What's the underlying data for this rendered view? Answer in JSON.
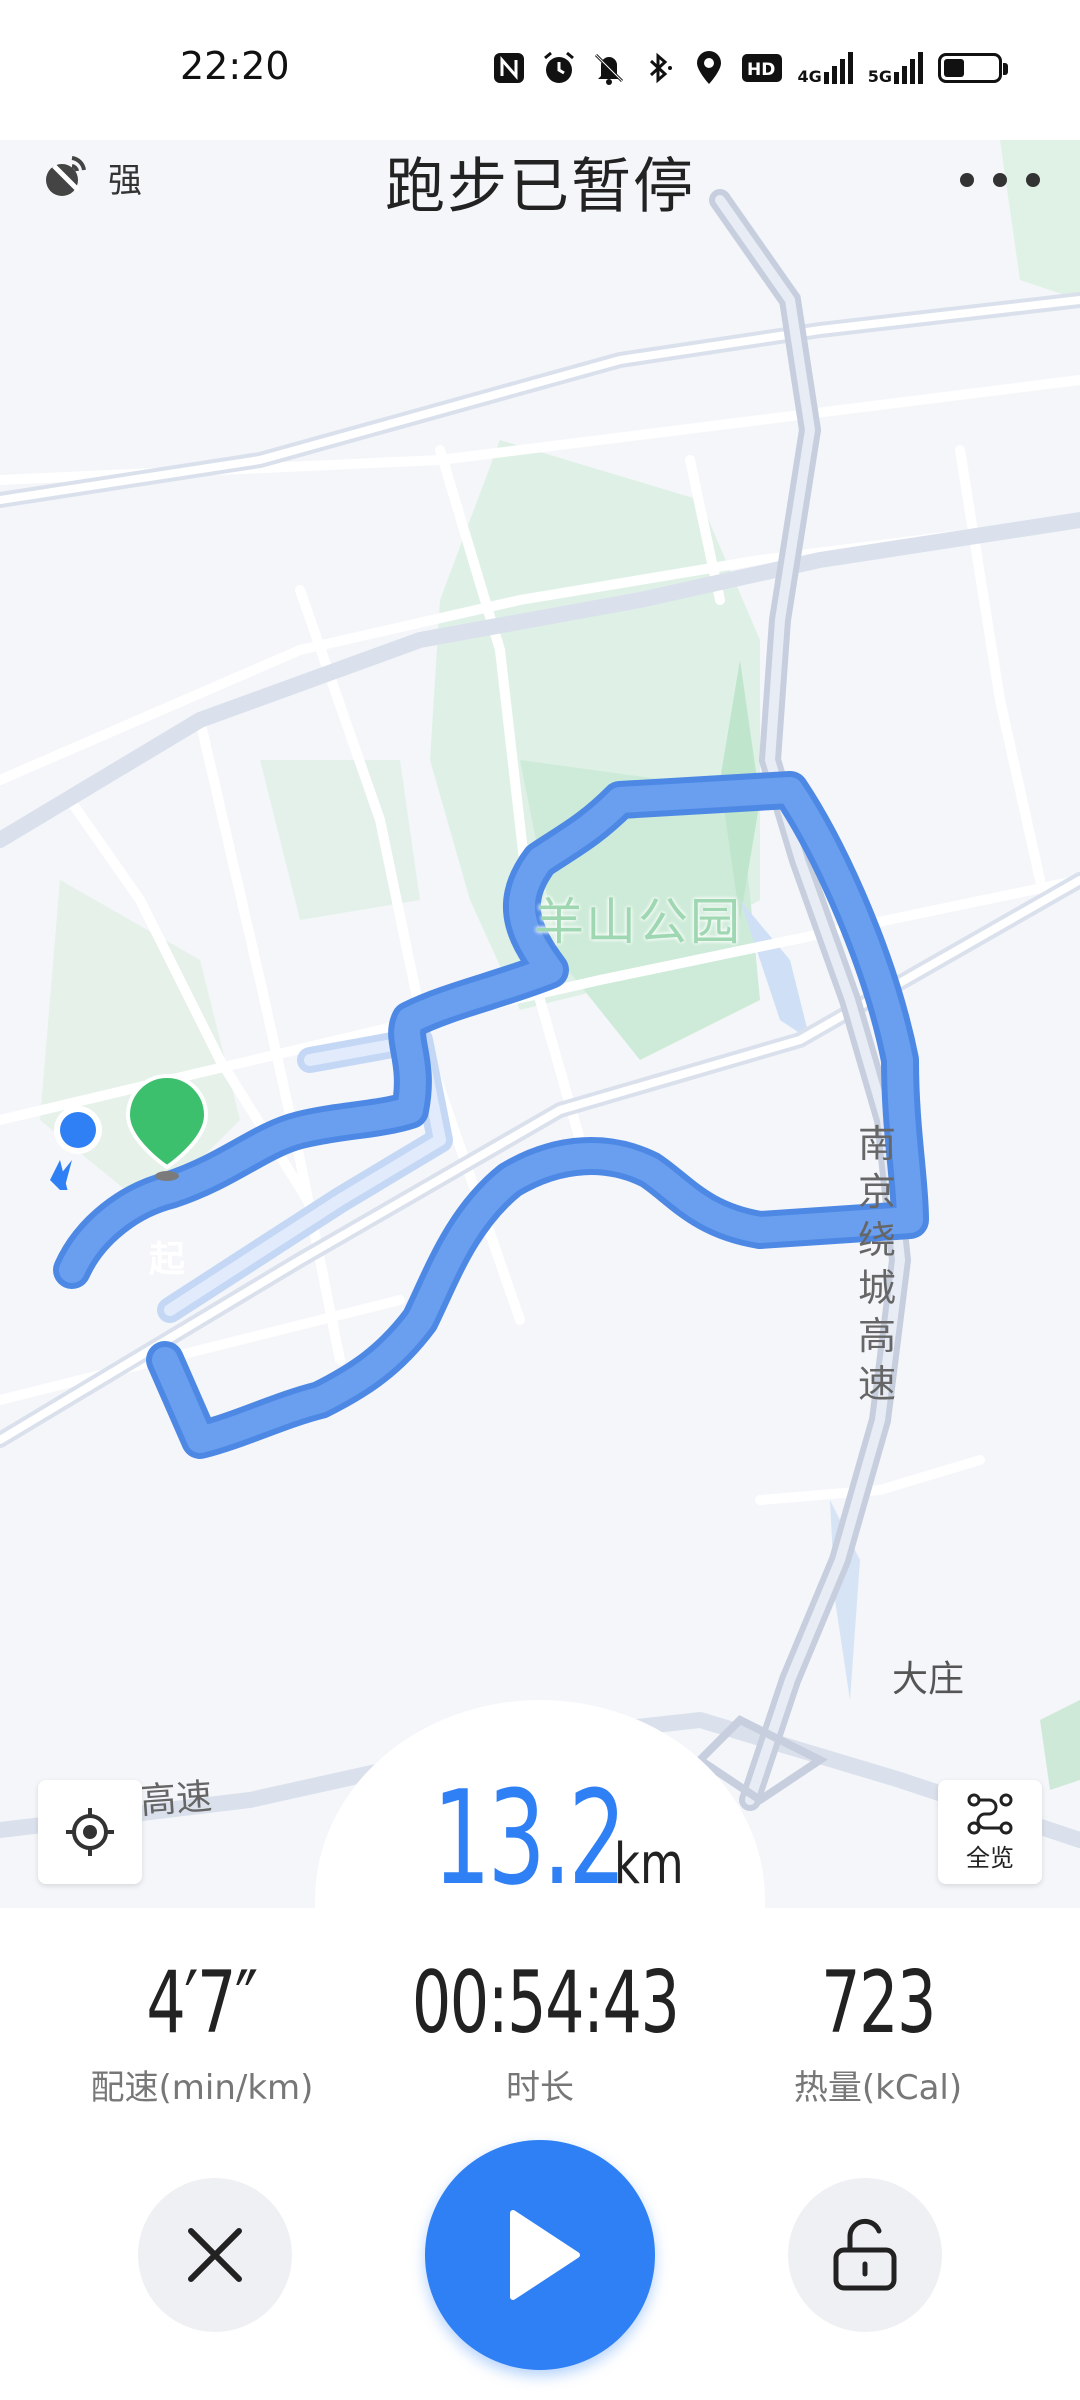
{
  "status_bar": {
    "time": "22:20",
    "icons": [
      "nfc-icon",
      "alarm-icon",
      "mute-icon",
      "bluetooth-icon",
      "location-icon",
      "hd-icon",
      "signal-4g-icon",
      "signal-5g-icon",
      "battery-icon"
    ],
    "net_4g": "4G",
    "net_5g": "5G"
  },
  "header": {
    "gps_label": "强",
    "title": "跑步已暂停"
  },
  "map": {
    "park_label": "羊山公园",
    "highway_label": "南京绕城高速",
    "village_label": "大庄",
    "road_label": "高速",
    "start_marker_label": "起"
  },
  "controls": {
    "overview_label": "全览"
  },
  "distance": {
    "value": "13.2",
    "unit": "km"
  },
  "stats": {
    "pace_value": "4′7″",
    "pace_label": "配速(min/km)",
    "duration_value": "00:54:43",
    "duration_label": "时长",
    "calories_value": "723",
    "calories_label": "热量(kCal)"
  },
  "colors": {
    "accent": "#2f80f4",
    "route": "#5b93ec",
    "park": "#d7efe0",
    "start_marker": "#3cc06d"
  }
}
